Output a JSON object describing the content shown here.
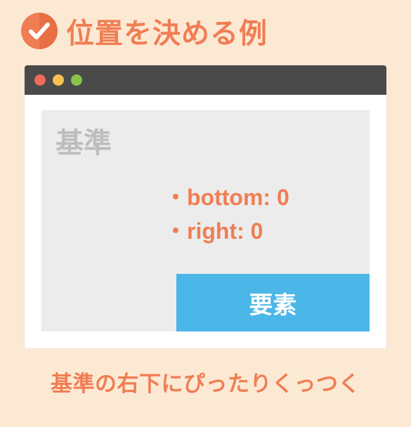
{
  "header": {
    "title": "位置を決める例"
  },
  "window": {
    "baseLabel": "基準",
    "rules": {
      "r1": "・bottom: 0",
      "r2": "・right: 0"
    },
    "elementLabel": "要素"
  },
  "caption": "基準の右下にぴったりくっつく"
}
